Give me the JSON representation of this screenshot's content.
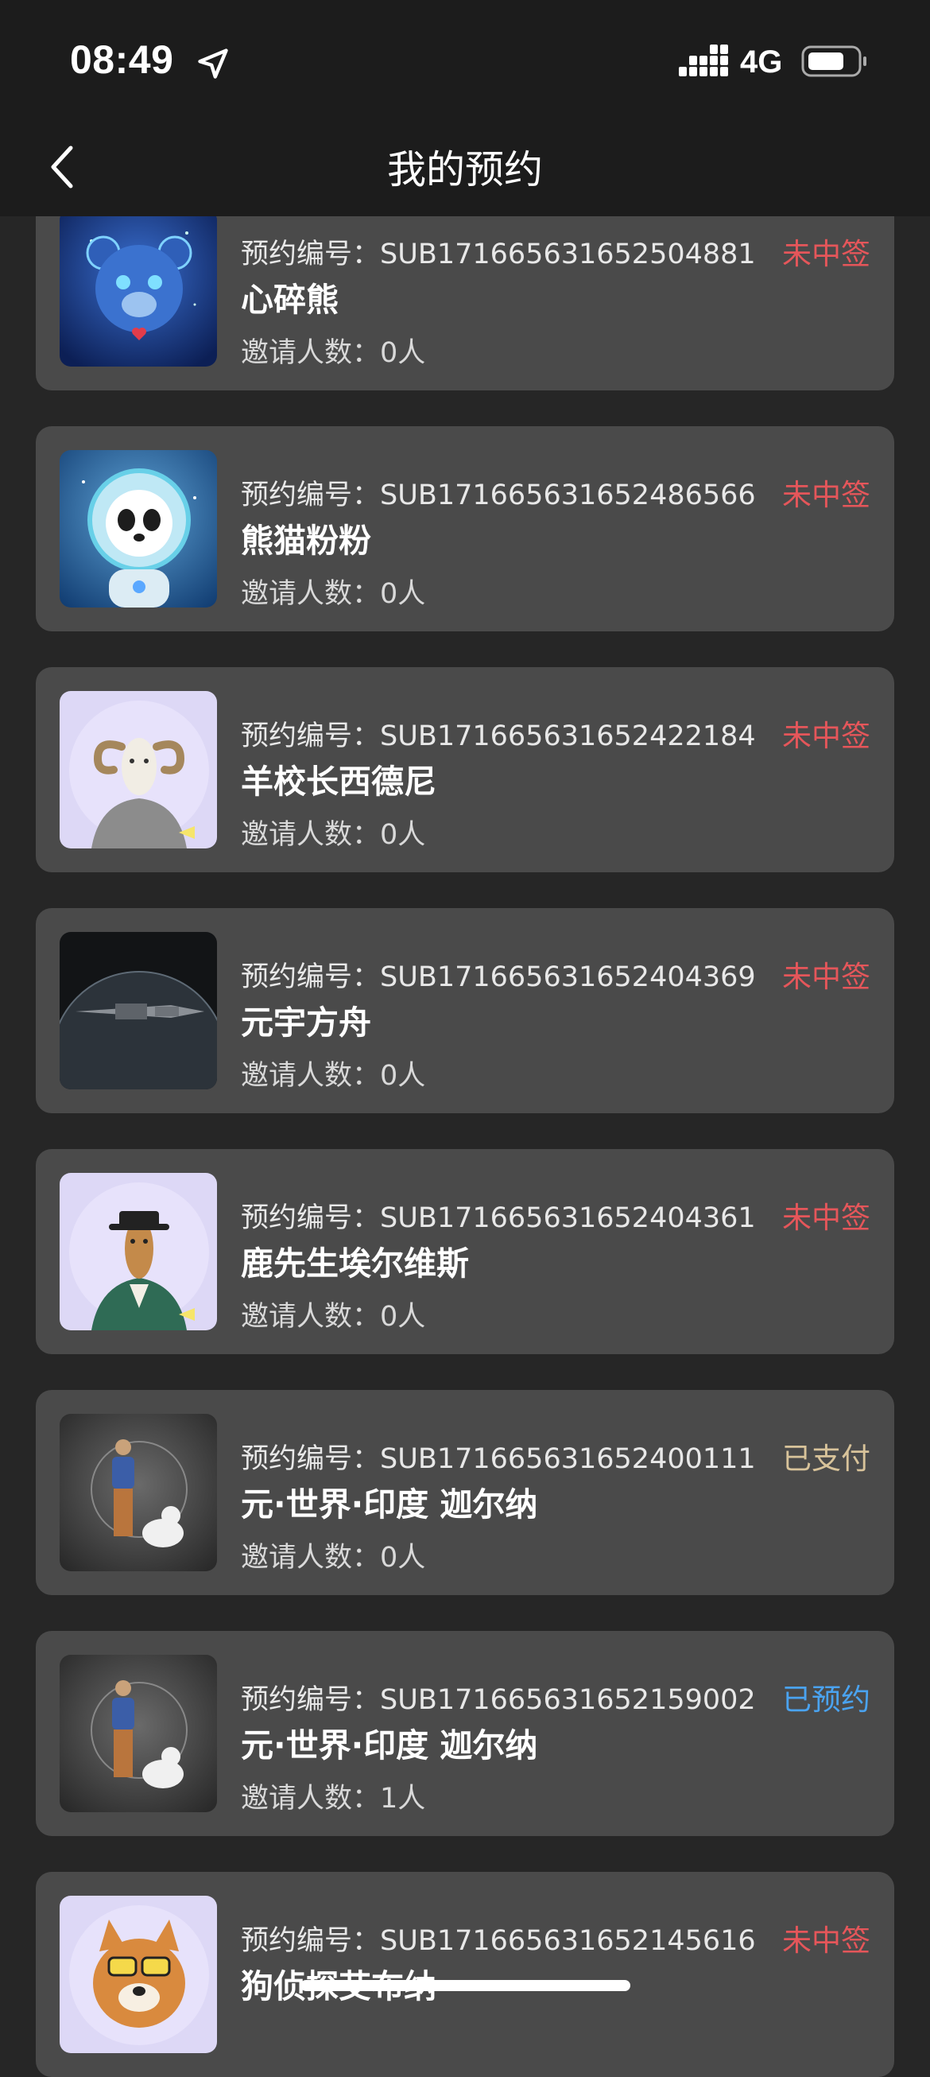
{
  "status_bar": {
    "time": "08:49",
    "network": "4G",
    "icons": [
      "location-arrow-icon",
      "signal-icon",
      "battery-icon"
    ]
  },
  "nav": {
    "back_icon": "chevron-left-icon",
    "title": "我的预约"
  },
  "labels": {
    "id_prefix": "预约编号：",
    "invite_prefix": "邀请人数："
  },
  "colors": {
    "not_won": "#e5565a",
    "paid": "#d8c39a",
    "reserved": "#4aa3f0",
    "card_bg": "#4a4a4a",
    "page_bg": "#262626"
  },
  "reservations": [
    {
      "id_label": "预约编号：SUB171665631652504881",
      "name": "心碎熊",
      "invite_label": "邀请人数：0人",
      "status": "未中签",
      "status_kind": "not_won",
      "thumb_icon": "cyber-bear-thumbnail"
    },
    {
      "id_label": "预约编号：SUB171665631652486566",
      "name": "熊猫粉粉",
      "invite_label": "邀请人数：0人",
      "status": "未中签",
      "status_kind": "not_won",
      "thumb_icon": "astronaut-panda-thumbnail"
    },
    {
      "id_label": "预约编号：SUB171665631652422184",
      "name": "羊校长西德尼",
      "invite_label": "邀请人数：0人",
      "status": "未中签",
      "status_kind": "not_won",
      "thumb_icon": "ram-in-sweater-thumbnail"
    },
    {
      "id_label": "预约编号：SUB171665631652404369",
      "name": "元宇方舟",
      "invite_label": "邀请人数：0人",
      "status": "未中签",
      "status_kind": "not_won",
      "thumb_icon": "spaceship-planet-thumbnail"
    },
    {
      "id_label": "预约编号：SUB171665631652404361",
      "name": "鹿先生埃尔维斯",
      "invite_label": "邀请人数：0人",
      "status": "未中签",
      "status_kind": "not_won",
      "thumb_icon": "deer-gentleman-thumbnail"
    },
    {
      "id_label": "预约编号：SUB171665631652400111",
      "name": "元·世界·印度 迦尔纳",
      "invite_label": "邀请人数：0人",
      "status": "已支付",
      "status_kind": "paid",
      "thumb_icon": "warrior-with-tiger-thumbnail"
    },
    {
      "id_label": "预约编号：SUB171665631652159002",
      "name": "元·世界·印度 迦尔纳",
      "invite_label": "邀请人数：1人",
      "status": "已预约",
      "status_kind": "reserved",
      "thumb_icon": "warrior-with-tiger-thumbnail"
    },
    {
      "id_label": "预约编号：SUB171665631652145616",
      "name": "狗侦探艾布纳",
      "invite_label": "",
      "status": "未中签",
      "status_kind": "not_won",
      "thumb_icon": "dog-detective-thumbnail"
    }
  ]
}
